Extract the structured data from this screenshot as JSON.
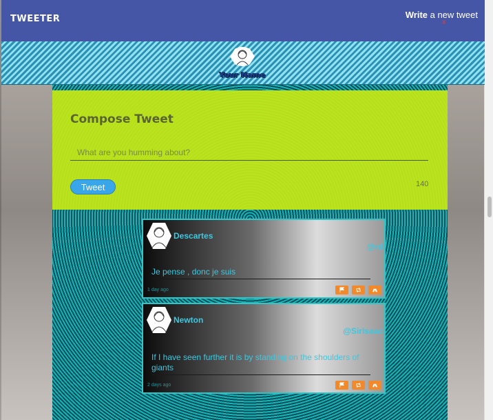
{
  "nav": {
    "logo": "TWEETER",
    "write_strong": "Write",
    "write_rest": " a new tweet",
    "chevron": "»"
  },
  "profile": {
    "name": "Your Name"
  },
  "compose": {
    "title": "Compose Tweet",
    "placeholder": "What are you humming about?",
    "button_label": "Tweet",
    "char_count": "140"
  },
  "tweets": [
    {
      "name": "Descartes",
      "handle": "@rd",
      "text": "Je pense , donc je suis",
      "time": "1 day ago"
    },
    {
      "name": "Newton",
      "handle": "@SirIsaac",
      "text": "If I have seen further it is by standing on the shoulders of giants",
      "time": "2 days ago"
    }
  ],
  "icons": {
    "flag": "flag-icon",
    "retweet": "retweet-icon",
    "like": "like-icon"
  },
  "colors": {
    "nav_bg": "#4656a6",
    "compose_bg": "#c4e816",
    "accent": "#3fc7df",
    "action": "#f2892a",
    "tweet_button": "#3aa6ea"
  }
}
